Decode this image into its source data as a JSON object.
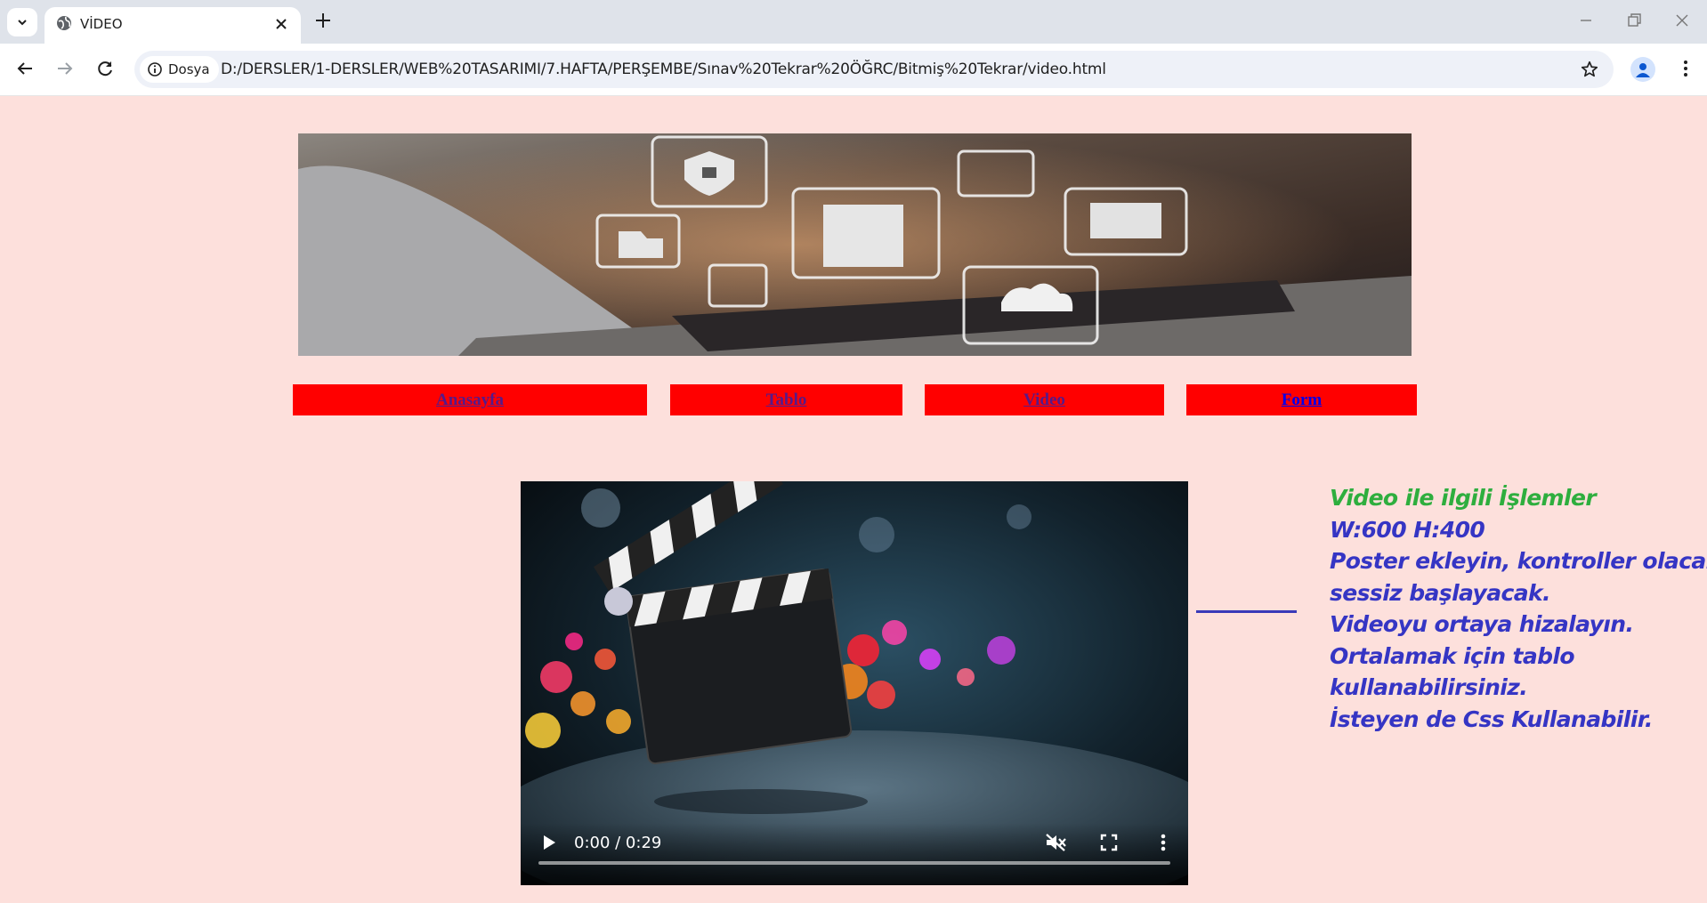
{
  "browser": {
    "tab_title": "VİDEO",
    "site_chip": "Dosya",
    "url": "D:/DERSLER/1-DERSLER/WEB%20TASARIMI/7.HAFTA/PERŞEMBE/Sınav%20Tekrar%20ÖĞRC/Bitmiş%20Tekrar/video.html"
  },
  "nav": {
    "items": [
      {
        "label": "Anasayfa"
      },
      {
        "label": "Tablo"
      },
      {
        "label": "Video"
      },
      {
        "label": "Form"
      }
    ]
  },
  "video": {
    "time": "0:00 / 0:29",
    "muted": true
  },
  "notes": {
    "lines": [
      "Video ile ilgili İşlemler",
      "W:600 H:400",
      "Poster ekleyin, kontroller olacak",
      "sessiz başlayacak.",
      "Videoyu ortaya hizalayın.",
      "Ortalamak için tablo",
      "kullanabilirsiniz.",
      "İsteyen de Css Kullanabilir."
    ]
  },
  "colors": {
    "page_bg": "#fde0dc",
    "nav_bg": "#ff0000",
    "note_blue": "#3535c4",
    "note_green": "#2eae3e"
  }
}
